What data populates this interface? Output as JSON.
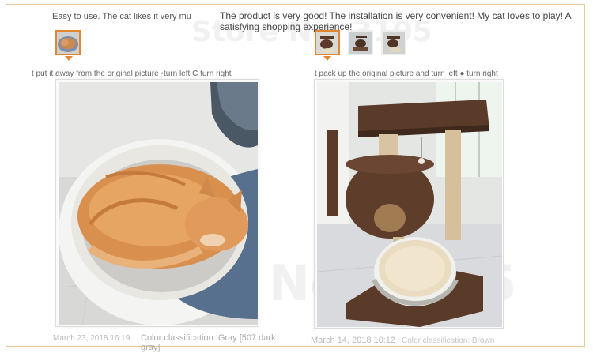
{
  "watermark": {
    "text_top": "Store No: 3105",
    "text_bottom": "No: 3105"
  },
  "reviews": [
    {
      "text": "Easy to use. The cat likes it very muc",
      "thumbnails": [
        {
          "name": "cat-in-bed",
          "active": true
        }
      ],
      "photo_caption": "t put it away from the original picture ◦turn left C turn right",
      "photo": {
        "subject": "orange cat sleeping in gray round cat bed"
      },
      "date": "March 23, 2018 16:19",
      "color_label": "Color classification: Gray [507 dark gray]"
    },
    {
      "text": "The product is very good! The installation is very convenient! My cat loves to play! A satisfying shopping experience!",
      "thumbnails": [
        {
          "name": "cat-tree-front",
          "active": true
        },
        {
          "name": "cat-tree-side",
          "active": false
        },
        {
          "name": "cat-tree-room",
          "active": false
        }
      ],
      "photo_caption": "t pack up the original picture and turn left ● turn right",
      "photo": {
        "subject": "brown cat tree with condo and bed"
      },
      "date": "March 14, 2018 10:12",
      "color_label": "Color classification: Brown"
    }
  ],
  "colors": {
    "accent": "#e4862f",
    "frame": "#e9c98f",
    "meta_text": "#bbbbbb"
  }
}
